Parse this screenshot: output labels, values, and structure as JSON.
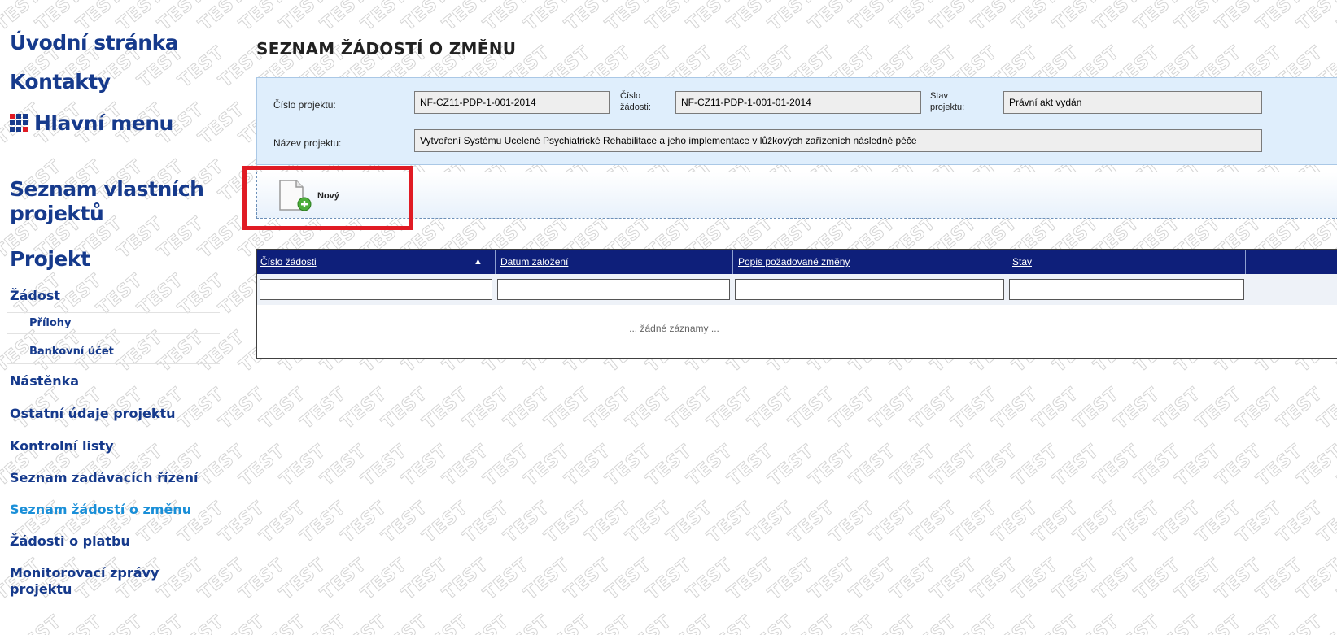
{
  "watermark": "TEST",
  "sidebar": {
    "home": "Úvodní stránka",
    "contacts": "Kontakty",
    "main_menu": "Hlavní menu",
    "own_projects": "Seznam vlastních projektů",
    "project": "Projekt",
    "items": [
      {
        "label": "Žádost"
      },
      {
        "label": "Přílohy"
      },
      {
        "label": "Bankovní účet"
      },
      {
        "label": "Nástěnka"
      },
      {
        "label": "Ostatní údaje projektu"
      },
      {
        "label": "Kontrolní listy"
      },
      {
        "label": "Seznam zadávacích řízení"
      },
      {
        "label": "Seznam žádostí o změnu"
      },
      {
        "label": "Žádosti o platbu"
      },
      {
        "label": "Monitorovací zprávy projektu"
      }
    ],
    "active_item": "Seznam žádostí o změnu"
  },
  "page": {
    "title": "SEZNAM ŽÁDOSTÍ O ZMĚNU"
  },
  "info": {
    "project_number_label": "Číslo projektu:",
    "project_number": "NF-CZ11-PDP-1-001-2014",
    "request_number_label_1": "Číslo",
    "request_number_label_2": "žádosti:",
    "request_number": "NF-CZ11-PDP-1-001-01-2014",
    "state_label_1": "Stav",
    "state_label_2": "projektu:",
    "state": "Právní akt vydán",
    "project_name_label": "Název projektu:",
    "project_name": "Vytvoření Systému Ucelené Psychiatrické Rehabilitace a jeho implementace v lůžkových zařízeních následné péče"
  },
  "toolbar": {
    "new_label": "Nový"
  },
  "table": {
    "columns": [
      {
        "label": "Číslo žádosti",
        "sorted": "asc"
      },
      {
        "label": "Datum založení"
      },
      {
        "label": "Popis požadované změny"
      },
      {
        "label": "Stav"
      }
    ],
    "sort_indicator": "▲",
    "empty_text": "... žádné záznamy ..."
  },
  "colors": {
    "nav": "#163a8c",
    "nav_active": "#1a8fd8",
    "grid_header": "#0e1f7a",
    "info_bg": "#dfeefc",
    "highlight": "#e01b24"
  }
}
